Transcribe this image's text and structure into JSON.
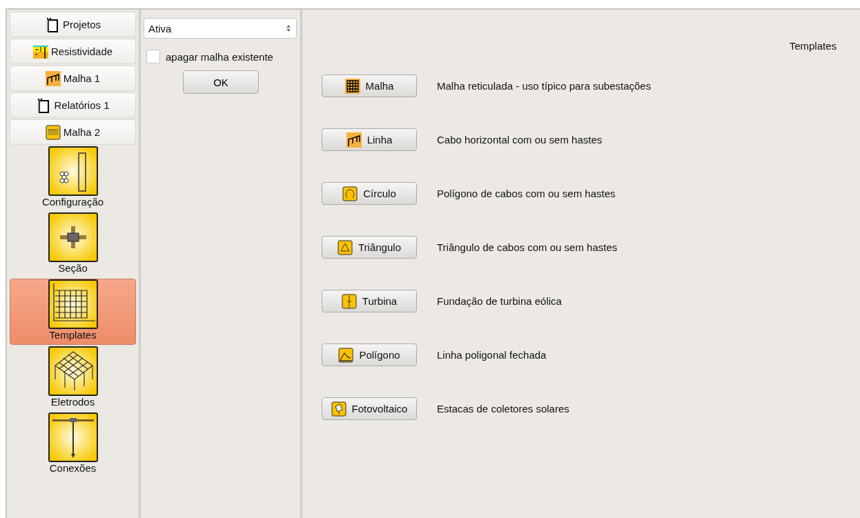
{
  "sidebar": {
    "buttons": [
      {
        "label": "Projetos",
        "kind": "doc"
      },
      {
        "label": "Resistividade",
        "kind": "resist"
      },
      {
        "label": "Malha 1",
        "kind": "line"
      },
      {
        "label": "Relatórios 1",
        "kind": "doc"
      },
      {
        "label": "Malha 2",
        "kind": "mesh"
      }
    ],
    "items": [
      {
        "label": "Configuração",
        "kind": "config",
        "selected": false
      },
      {
        "label": "Seção",
        "kind": "section",
        "selected": false
      },
      {
        "label": "Templates",
        "kind": "grid",
        "selected": true
      },
      {
        "label": "Eletrodos",
        "kind": "electrodes",
        "selected": false
      },
      {
        "label": "Conexões",
        "kind": "connection",
        "selected": false
      }
    ]
  },
  "options": {
    "dropdown": "Ativa",
    "checkbox": {
      "label": "apagar malha existente",
      "checked": false
    },
    "button": "OK"
  },
  "templates": {
    "title": "Templates",
    "rows": [
      {
        "label": "Malha",
        "kind": "mesh",
        "description": "Malha reticulada - uso típico para subestações"
      },
      {
        "label": "Linha",
        "kind": "line",
        "description": "Cabo horizontal com ou sem hastes"
      },
      {
        "label": "Círculo",
        "kind": "circle",
        "description": "Polígono de cabos com ou sem hastes"
      },
      {
        "label": "Triângulo",
        "kind": "triangle",
        "description": "Triângulo de cabos com ou sem hastes"
      },
      {
        "label": "Turbina",
        "kind": "turbine",
        "description": "Fundação de turbina eólica"
      },
      {
        "label": "Polígono",
        "kind": "polygon",
        "description": "Linha poligonal fechada"
      },
      {
        "label": "Fotovoltaico",
        "kind": "solar",
        "description": "Estacas de coletores solares"
      }
    ]
  }
}
